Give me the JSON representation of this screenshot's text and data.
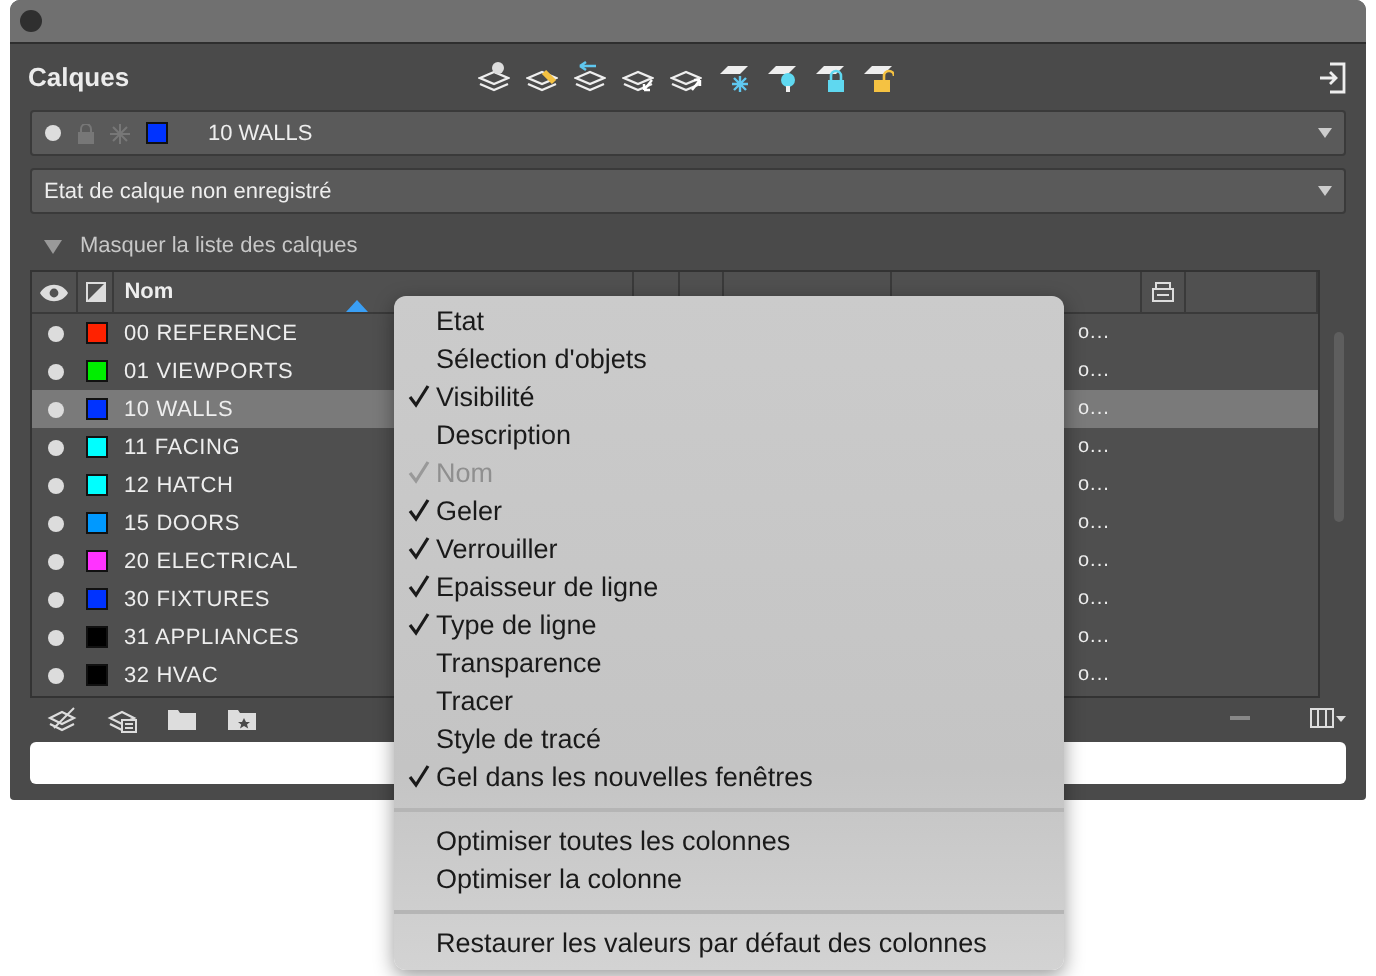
{
  "panel": {
    "title": "Calques"
  },
  "current_layer": {
    "name": "10 WALLS",
    "color": "#0033ff"
  },
  "layer_state": {
    "value": "Etat de calque non enregistré"
  },
  "toggle": {
    "label": "Masquer la liste des calques",
    "expanded": true
  },
  "table": {
    "columns": [
      {
        "label": "Nom",
        "sorted": true
      }
    ],
    "rows": [
      {
        "name": "00 REFERENCE",
        "color": "#ff2200",
        "selected": false,
        "column_6": "o..."
      },
      {
        "name": "01 VIEWPORTS",
        "color": "#00ee00",
        "selected": false,
        "column_6": "o..."
      },
      {
        "name": "10 WALLS",
        "color": "#0033ff",
        "selected": true,
        "column_6": "o..."
      },
      {
        "name": "11 FACING",
        "color": "#00ffff",
        "selected": false,
        "column_6": "o..."
      },
      {
        "name": "12 HATCH",
        "color": "#00ffff",
        "selected": false,
        "column_6": "o..."
      },
      {
        "name": "15 DOORS",
        "color": "#0099ff",
        "selected": false,
        "column_6": "o..."
      },
      {
        "name": "20 ELECTRICAL",
        "color": "#ff33ff",
        "selected": false,
        "column_6": "o..."
      },
      {
        "name": "30 FIXTURES",
        "color": "#0033ff",
        "selected": false,
        "column_6": "o..."
      },
      {
        "name": "31 APPLIANCES",
        "color": "#000000",
        "selected": false,
        "column_6": "o..."
      },
      {
        "name": "32 HVAC",
        "color": "#000000",
        "selected": false,
        "column_6": "o..."
      }
    ]
  },
  "context_menu": {
    "groups": [
      [
        {
          "label": "Etat",
          "checked": false,
          "disabled": false
        },
        {
          "label": "Sélection d'objets",
          "checked": false,
          "disabled": false
        },
        {
          "label": "Visibilité",
          "checked": true,
          "disabled": false
        },
        {
          "label": "Description",
          "checked": false,
          "disabled": false
        },
        {
          "label": "Nom",
          "checked": true,
          "disabled": true
        },
        {
          "label": "Geler",
          "checked": true,
          "disabled": false
        },
        {
          "label": "Verrouiller",
          "checked": true,
          "disabled": false
        },
        {
          "label": "Epaisseur de ligne",
          "checked": true,
          "disabled": false
        },
        {
          "label": "Type de ligne",
          "checked": true,
          "disabled": false
        },
        {
          "label": "Transparence",
          "checked": false,
          "disabled": false
        },
        {
          "label": "Tracer",
          "checked": false,
          "disabled": false
        },
        {
          "label": "Style de tracé",
          "checked": false,
          "disabled": false
        },
        {
          "label": "Gel dans les nouvelles fenêtres",
          "checked": true,
          "disabled": false
        }
      ],
      [
        {
          "label": "Optimiser toutes les colonnes",
          "checked": false,
          "disabled": false
        },
        {
          "label": "Optimiser la colonne",
          "checked": false,
          "disabled": false
        }
      ],
      [
        {
          "label": "Restaurer les valeurs par défaut des colonnes",
          "checked": false,
          "disabled": false
        }
      ]
    ]
  }
}
